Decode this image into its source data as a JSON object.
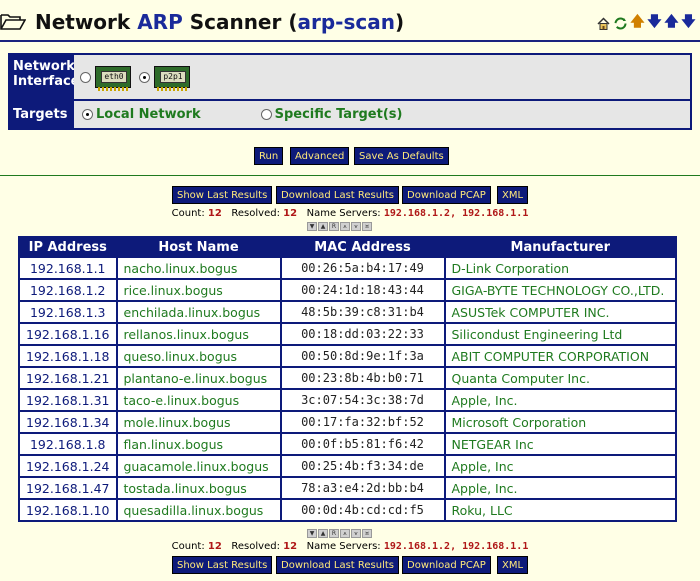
{
  "header": {
    "title_word1": "Network",
    "title_word2": "ARP",
    "title_word3": "Scanner",
    "title_paren": "(arp-scan)",
    "icons": [
      "home-icon",
      "refresh-icon",
      "arrow-up-icon",
      "arrow-down-icon",
      "arrow-up-down-icon"
    ]
  },
  "form": {
    "network_interface_label": "Network Interface",
    "interfaces": [
      {
        "chip": "eth0",
        "selected": false
      },
      {
        "chip": "p2p1",
        "selected": true
      }
    ],
    "targets_label": "Targets",
    "target_local": "Local Network",
    "target_specific": "Specific Target(s)",
    "target_selected": "local"
  },
  "buttons": {
    "run": "Run",
    "advanced": "Advanced",
    "save_defaults": "Save As Defaults",
    "show_last": "Show Last Results",
    "download_last": "Download Last Results",
    "download_pcap": "Download PCAP",
    "xml": "XML"
  },
  "summary": {
    "count_label": "Count:",
    "count": "12",
    "resolved_label": "Resolved:",
    "resolved": "12",
    "ns_label": "Name Servers:",
    "name_servers": "192.168.1.2, 192.168.1.1"
  },
  "table": {
    "headers": [
      "IP Address",
      "Host Name",
      "MAC Address",
      "Manufacturer"
    ],
    "rows": [
      [
        "192.168.1.1",
        "nacho.linux.bogus",
        "00:26:5a:b4:17:49",
        "D-Link Corporation"
      ],
      [
        "192.168.1.2",
        "rice.linux.bogus",
        "00:24:1d:18:43:44",
        "GIGA-BYTE TECHNOLOGY CO.,LTD."
      ],
      [
        "192.168.1.3",
        "enchilada.linux.bogus",
        "48:5b:39:c8:31:b4",
        "ASUSTek COMPUTER INC."
      ],
      [
        "192.168.1.16",
        "rellanos.linux.bogus",
        "00:18:dd:03:22:33",
        "Silicondust Engineering Ltd"
      ],
      [
        "192.168.1.18",
        "queso.linux.bogus",
        "00:50:8d:9e:1f:3a",
        "ABIT COMPUTER CORPORATION"
      ],
      [
        "192.168.1.21",
        "plantano-e.linux.bogus",
        "00:23:8b:4b:b0:71",
        "Quanta Computer Inc."
      ],
      [
        "192.168.1.31",
        "taco-e.linux.bogus",
        "3c:07:54:3c:38:7d",
        "Apple, Inc."
      ],
      [
        "192.168.1.34",
        "mole.linux.bogus",
        "00:17:fa:32:bf:52",
        "Microsoft Corporation"
      ],
      [
        "192.168.1.8",
        "flan.linux.bogus",
        "00:0f:b5:81:f6:42",
        "NETGEAR Inc"
      ],
      [
        "192.168.1.24",
        "guacamole.linux.bogus",
        "00:25:4b:f3:34:de",
        "Apple, Inc"
      ],
      [
        "192.168.1.47",
        "tostada.linux.bogus",
        "78:a3:e4:2d:bb:b4",
        "Apple, Inc."
      ],
      [
        "192.168.1.10",
        "quesadilla.linux.bogus",
        "00:0d:4b:cd:cd:f5",
        "Roku, LLC"
      ]
    ]
  },
  "pager": [
    "▼",
    "▲",
    "R",
    "⩚",
    "⩛",
    "¤"
  ]
}
